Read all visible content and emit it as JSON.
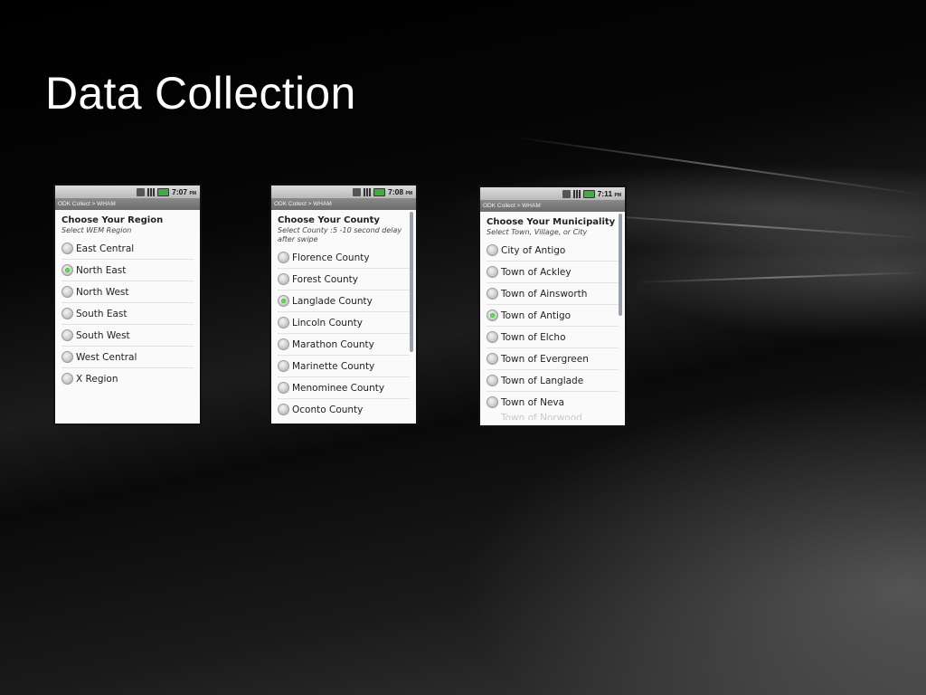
{
  "slide": {
    "title": "Data Collection"
  },
  "screens": [
    {
      "status_time": "7:07",
      "status_ampm": "PM",
      "app_bar": "ODK Collect > WHAM",
      "question": "Choose Your Region",
      "hint": "Select WEM Region",
      "options": [
        {
          "label": "East Central",
          "selected": false
        },
        {
          "label": "North East",
          "selected": true
        },
        {
          "label": "North West",
          "selected": false
        },
        {
          "label": "South East",
          "selected": false
        },
        {
          "label": "South West",
          "selected": false
        },
        {
          "label": "West Central",
          "selected": false
        },
        {
          "label": "X Region",
          "selected": false
        }
      ]
    },
    {
      "status_time": "7:08",
      "status_ampm": "PM",
      "app_bar": "ODK Collect > WHAM",
      "question": "Choose Your County",
      "hint": "Select County :5 -10 second delay after swipe",
      "options": [
        {
          "label": "Florence County",
          "selected": false
        },
        {
          "label": "Forest County",
          "selected": false
        },
        {
          "label": "Langlade County",
          "selected": true
        },
        {
          "label": "Lincoln County",
          "selected": false
        },
        {
          "label": "Marathon County",
          "selected": false
        },
        {
          "label": "Marinette County",
          "selected": false
        },
        {
          "label": "Menominee County",
          "selected": false
        },
        {
          "label": "Oconto County",
          "selected": false
        }
      ]
    },
    {
      "status_time": "7:11",
      "status_ampm": "PM",
      "app_bar": "ODK Collect > WHAM",
      "question": "Choose Your Municipality",
      "hint": "Select Town, Village, or City",
      "options": [
        {
          "label": "City of Antigo",
          "selected": false
        },
        {
          "label": "Town of Ackley",
          "selected": false
        },
        {
          "label": "Town of Ainsworth",
          "selected": false
        },
        {
          "label": "Town of Antigo",
          "selected": true
        },
        {
          "label": "Town of Elcho",
          "selected": false
        },
        {
          "label": "Town of Evergreen",
          "selected": false
        },
        {
          "label": "Town of Langlade",
          "selected": false
        },
        {
          "label": "Town of Neva",
          "selected": false
        }
      ],
      "partial_option": "Town of Norwood"
    }
  ]
}
